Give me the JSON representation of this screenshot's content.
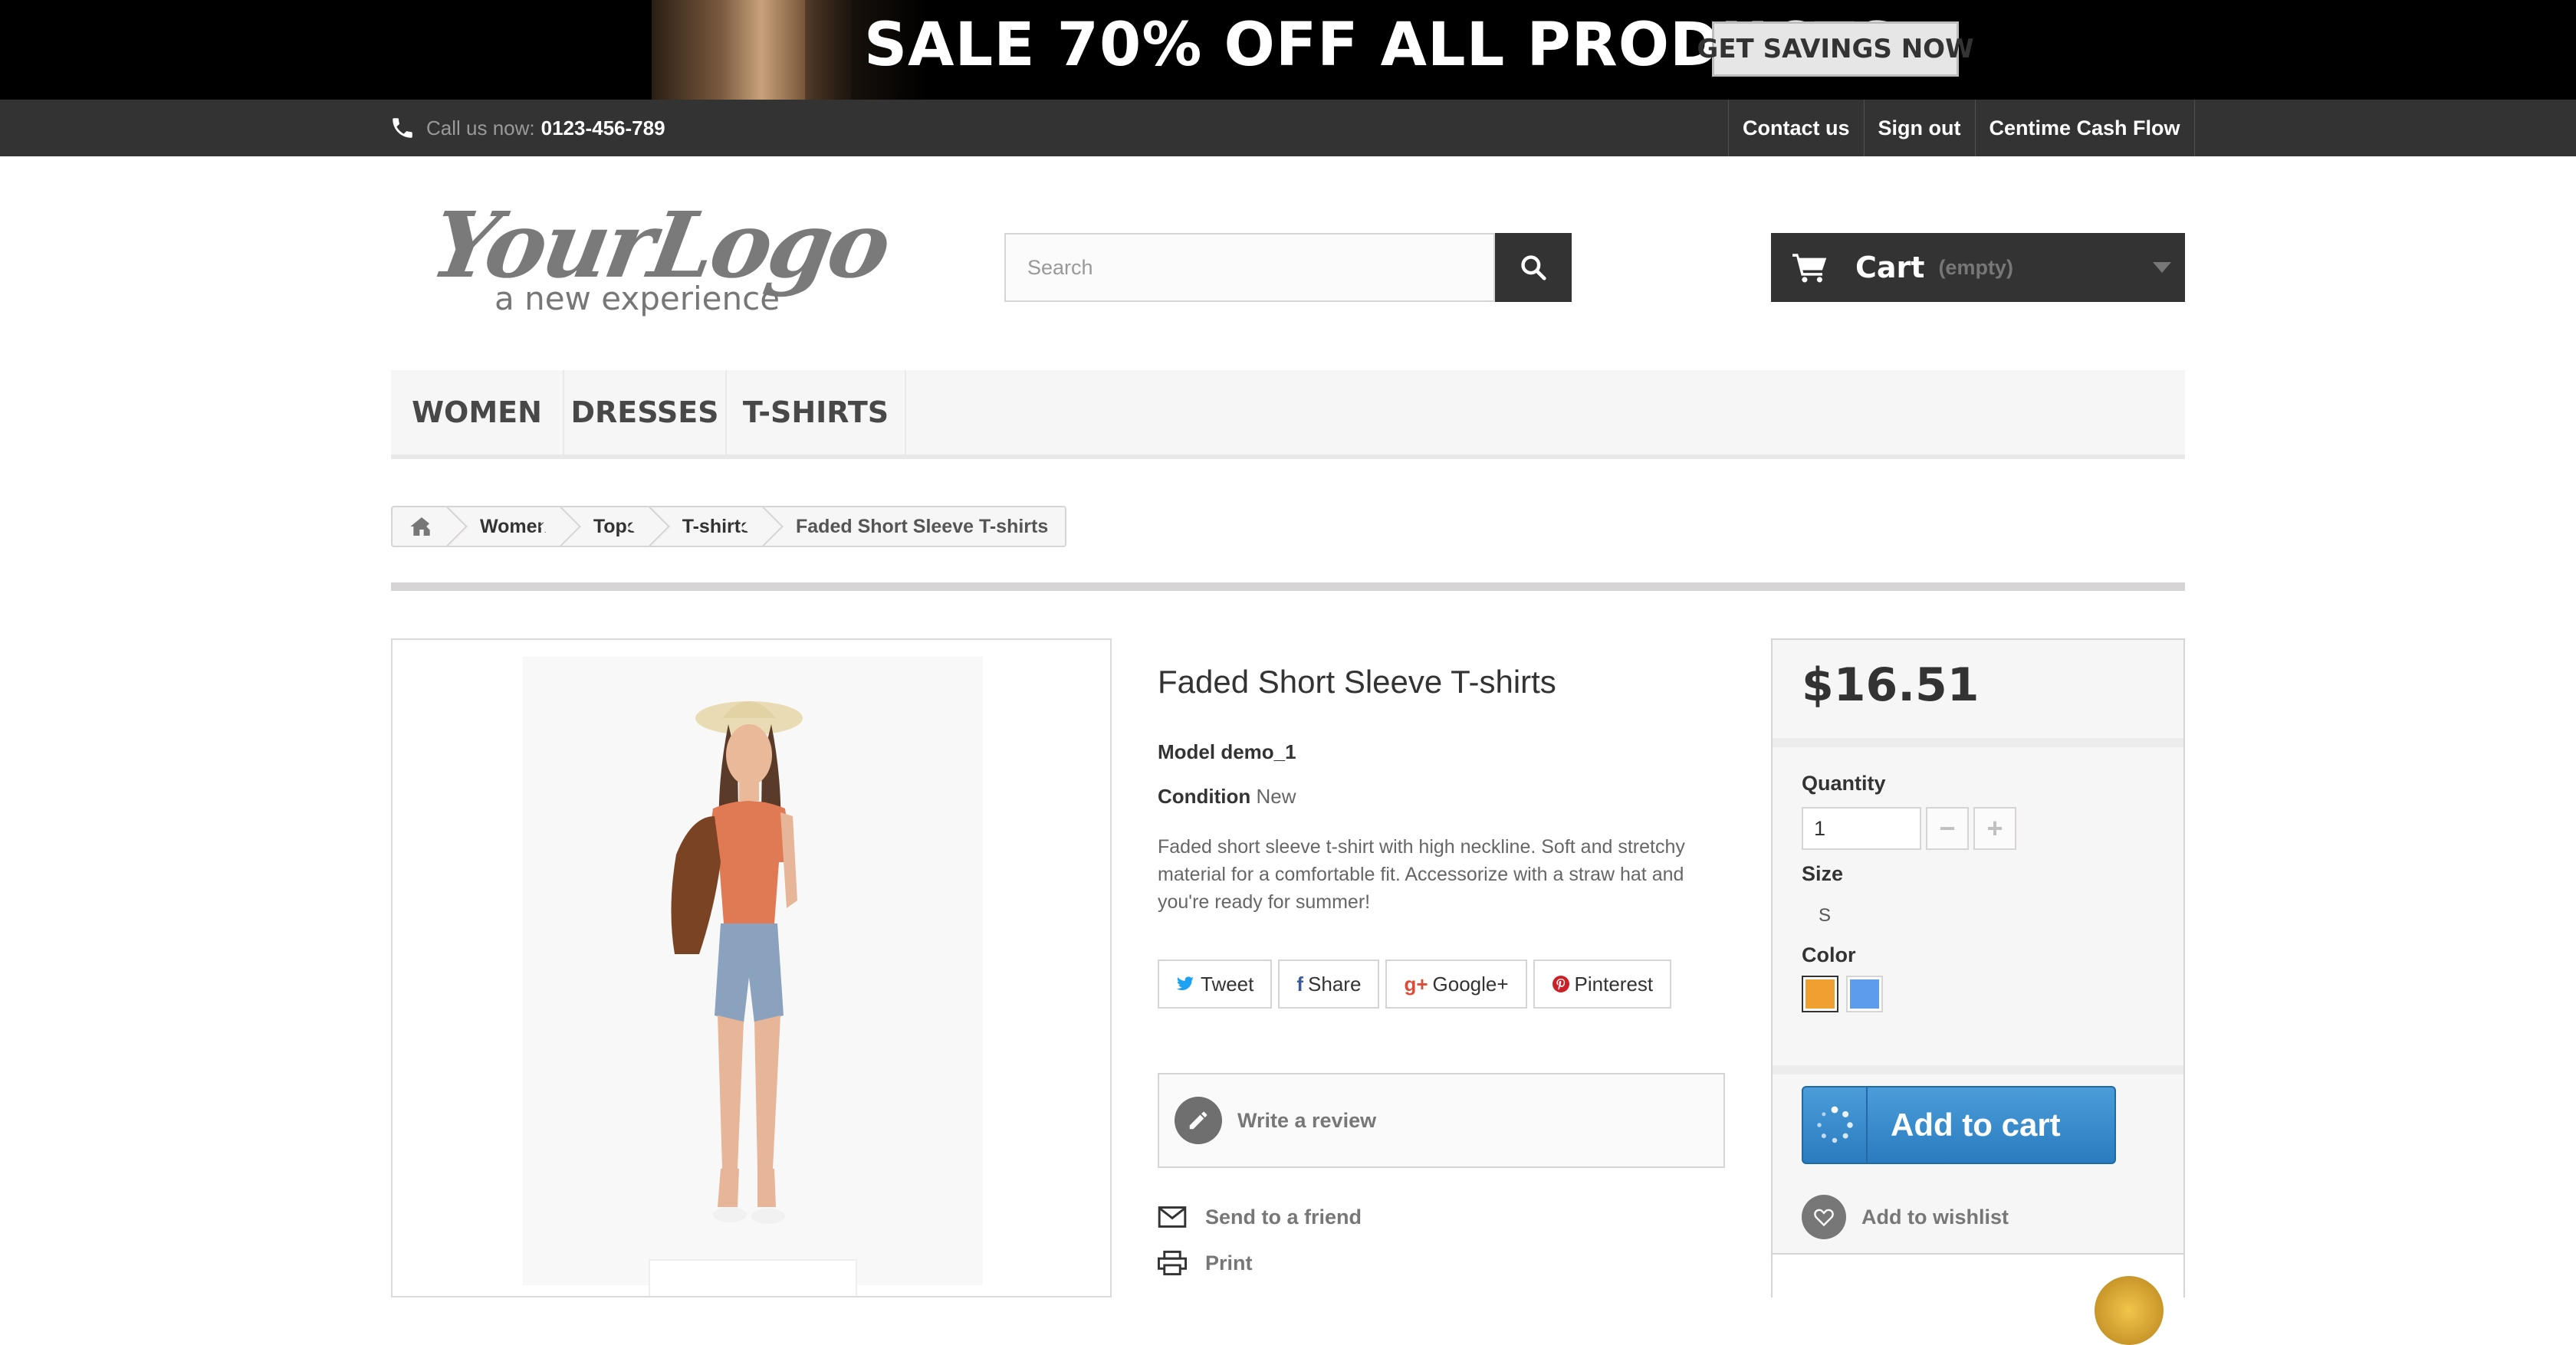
{
  "banner": {
    "text": "SALE 70% OFF ALL PRODUCTS",
    "button": "GET SAVINGS NOW"
  },
  "topbar": {
    "call_label": "Call us now:",
    "phone": "0123-456-789",
    "links": [
      "Contact us",
      "Sign out",
      "Centime Cash Flow"
    ]
  },
  "logo": {
    "name": "YourLogo",
    "tagline": "a new experience"
  },
  "search": {
    "placeholder": "Search"
  },
  "cart": {
    "label": "Cart",
    "status": "(empty)"
  },
  "menu": {
    "items": [
      "WOMEN",
      "DRESSES",
      "T-SHIRTS"
    ]
  },
  "breadcrumb": {
    "items": [
      "Women",
      "Tops",
      "T-shirts",
      "Faded Short Sleeve T-shirts"
    ]
  },
  "product": {
    "title": "Faded Short Sleeve T-shirts",
    "model_label": "Model",
    "model": "demo_1",
    "condition_label": "Condition",
    "condition": "New",
    "description": "Faded short sleeve t-shirt with high neckline. Soft and stretchy material for a comfortable fit. Accessorize with a straw hat and you're ready for summer!",
    "share": [
      "Tweet",
      "Share",
      "Google+",
      "Pinterest"
    ],
    "review": "Write a review",
    "send_friend": "Send to a friend",
    "print": "Print"
  },
  "buy": {
    "price": "$16.51",
    "quantity_label": "Quantity",
    "quantity": "1",
    "size_label": "Size",
    "size": "S",
    "color_label": "Color",
    "colors": [
      "#f0a030",
      "#5d9cec"
    ],
    "add_to_cart": "Add to cart",
    "wishlist": "Add to wishlist"
  }
}
